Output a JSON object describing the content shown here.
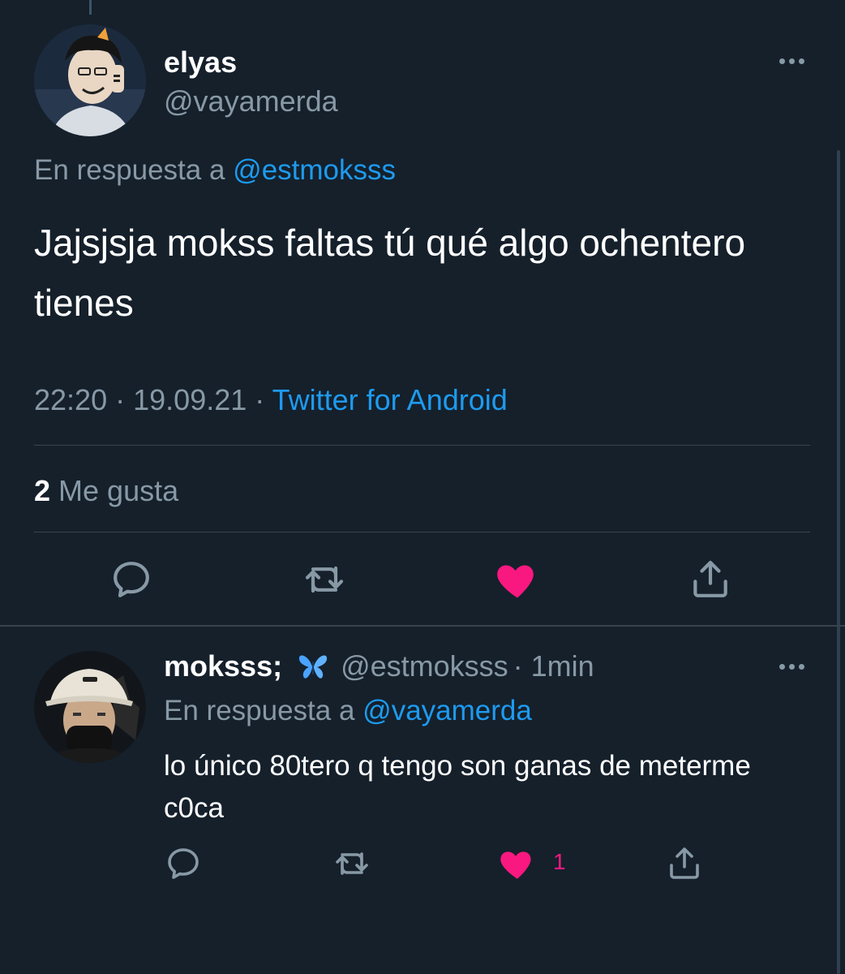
{
  "main_tweet": {
    "display_name": "elyas",
    "handle": "@vayamerda",
    "reply_prefix": "En respuesta a",
    "reply_to": "@estmoksss",
    "text": "Jajsjsja mokss faltas tú qué algo ochentero tienes",
    "time": "22:20",
    "date": "19.09.21",
    "separator": "·",
    "source": "Twitter for Android",
    "likes_count": "2",
    "likes_label": "Me gusta",
    "liked": true
  },
  "reply_tweet": {
    "display_name": "moksss;",
    "emoji": "butterfly",
    "handle": "@estmoksss",
    "age": "· 1min",
    "reply_prefix": "En respuesta a",
    "reply_to": "@vayamerda",
    "text": "lo único 80tero q tengo son ganas de meterme c0ca",
    "like_count": "1",
    "liked": true
  },
  "icons": [
    "more-icon",
    "reply-icon",
    "retweet-icon",
    "like-icon",
    "share-icon"
  ],
  "colors": {
    "background": "#15202b",
    "text": "#ffffff",
    "secondary_text": "#8899a6",
    "link": "#1d9bf0",
    "like": "#f91880",
    "divider": "#38444d"
  }
}
